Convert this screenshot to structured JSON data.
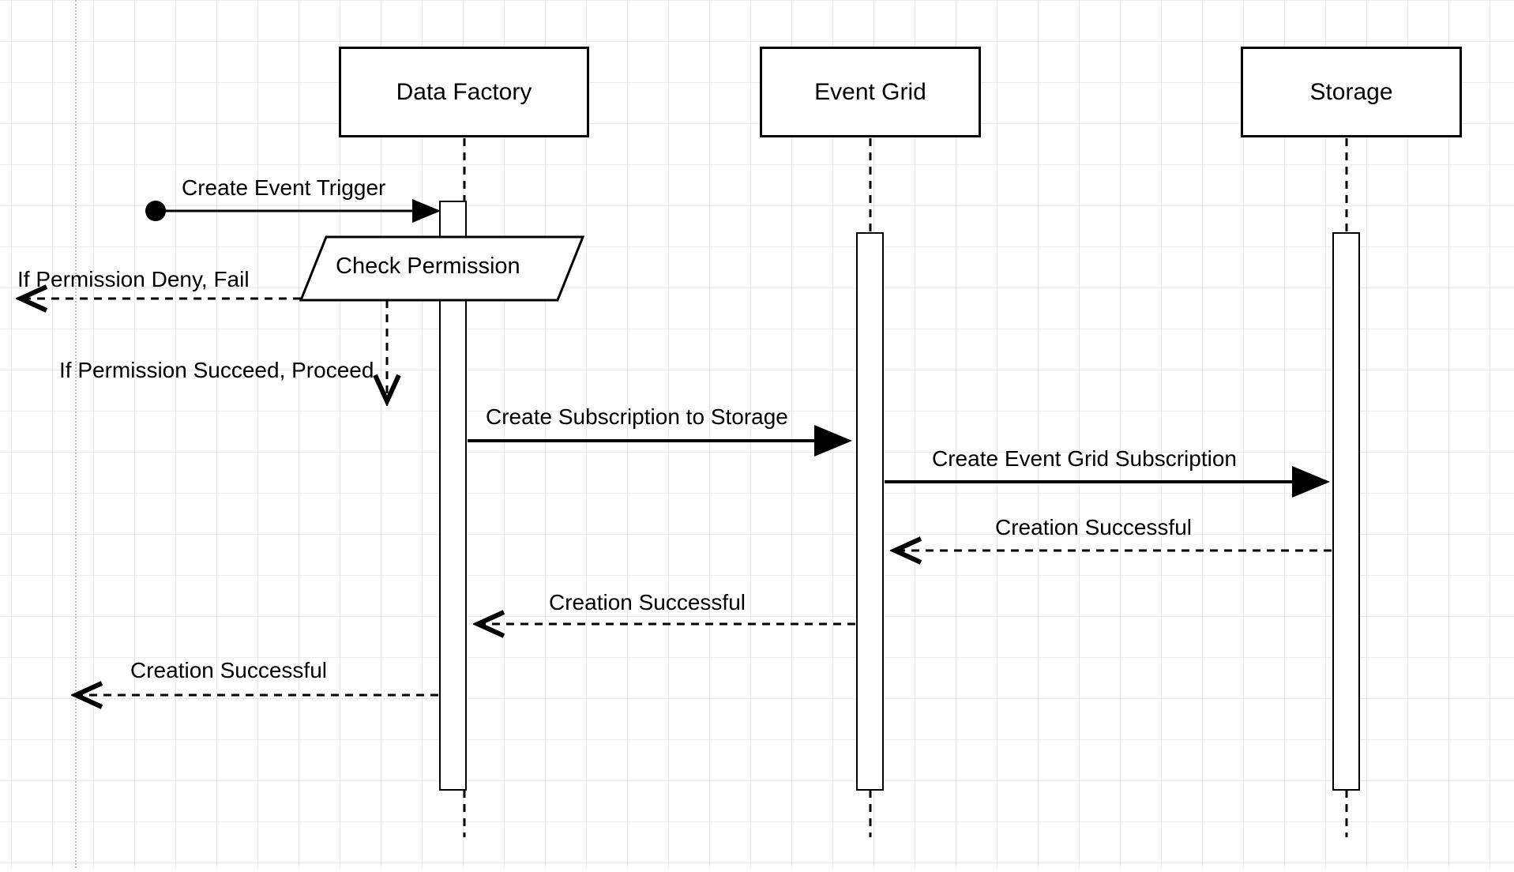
{
  "diagram": {
    "type": "sequence",
    "participants": {
      "data_factory": "Data Factory",
      "event_grid": "Event Grid",
      "storage": "Storage"
    },
    "process_box": "Check Permission",
    "messages": {
      "create_event_trigger": "Create Event Trigger",
      "permission_deny": "If Permission Deny, Fail",
      "permission_succeed": "If Permission Succeed, Proceed",
      "create_subscription": "Create Subscription to Storage",
      "create_eg_subscription": "Create Event Grid Subscription",
      "creation_success_1": "Creation Successful",
      "creation_success_2": "Creation Successful",
      "creation_success_3": "Creation Successful"
    }
  }
}
